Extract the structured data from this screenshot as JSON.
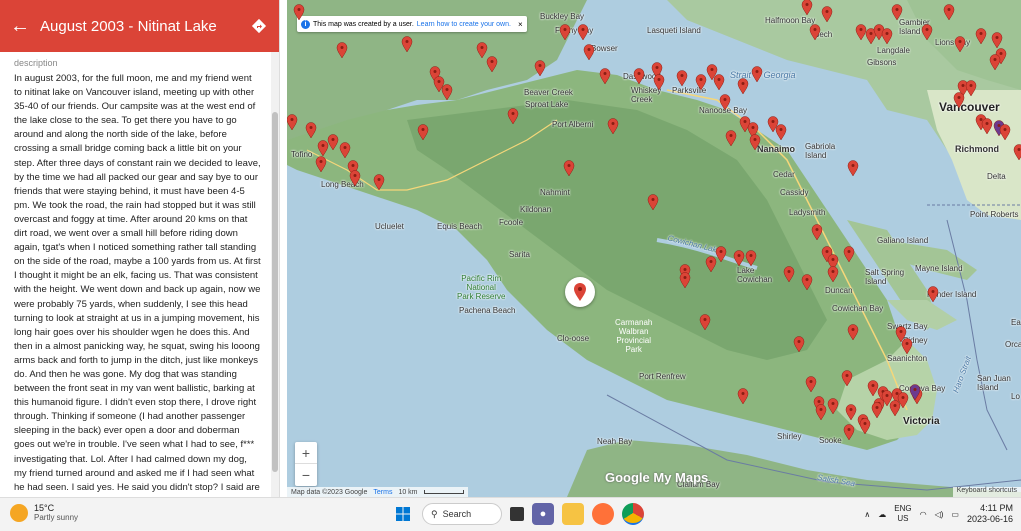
{
  "panel": {
    "title": "August 2003 - Nitinat Lake",
    "description_label": "description",
    "description": "In august 2003, for the full moon, me and my friend went to nitinat lake on Vancouver island, meeting up with other 35-40 of our friends. Our campsite was at the west end of the lake close to the sea. To get there you have to go around and along the north side of the lake, before crossing a small bridge coming back a little bit on your step. After three days of constant rain we decided to leave, by the time we had all packed our gear and say bye to our friends that were staying behind, it must have been 4-5 pm. We took the road, the rain had stopped but it was still overcast and foggy at time. After around 20 kms on that dirt road, we went over a small hill before riding down again, tgat's when I noticed something rather tall standing on the side of the road, maybe a 100 yards from us. At first I thought it might be an elk, facing us. That was consistent with the height. We went down and back up again, now we were probably 75 yards, when suddenly, I see this head turning to look at straight at us in a jumping movement, his long hair goes over his shoulder wgen he does this. And then in a almost panicking way, he squat, swing his looong arms back and forth to jump in the ditch, just like monkeys do. And then he was gone. My dog that was standing between the front seat in my van went ballistic, barking at this humanoid figure. I didn't even stop there, I drove right through. Thinking if someone (I had another passenger sleeping in the back) ever open a door and doberman goes out we're in trouble. I've seen what I had to see, f*** investigating that. Lol. After I had calmed down my dog, my friend turned around and asked me if I had seen what he had seen. I said yes. He said you didn't stop? I said are you crazy??? In a scary voice Lol So that was our sighting.. - Patrick Lepage report."
  },
  "map": {
    "notice_text": "This map was created by a user.",
    "notice_link": "Learn how to create your own.",
    "attribution": "Map data ©2023 Google",
    "terms": "Terms",
    "scale": "10 km",
    "keyboard": "Keyboard shortcuts",
    "logo": "Google My Maps",
    "zoom_in": "+",
    "zoom_out": "−",
    "labels": {
      "buckley_bay": "Buckley Bay",
      "lasqueti": "Lasqueti Island",
      "halfmoon": "Halfmoon Bay",
      "sechelt": "Sech",
      "gambier": "Gambier\nIsland",
      "lions_bay": "Lions Bay",
      "langdale": "Langdale",
      "gibsons": "Gibsons",
      "fanny_bay": "Fanny Bay",
      "bowser": "Bowser",
      "strait": "Strait of Georgia",
      "dashwood": "Dashwood",
      "whiskey": "Whiskey\nCreek",
      "parksville": "Parksville",
      "beaver": "Beaver Creek",
      "sproat": "Sproat Lake",
      "nanoose": "Nanoose Bay",
      "vancouver": "Vancouver",
      "port_alberni": "Port Alberni",
      "nanaimo": "Nanaimo",
      "gabriola": "Gabriola\nIsland",
      "richmond": "Richmond",
      "tofino": "Tofino",
      "delta": "Delta",
      "long_beach": "Long Beach",
      "cedar": "Cedar",
      "cassidy": "Cassidy",
      "nahmint": "Nahmint",
      "kildonan": "Kildonan",
      "ucluelet": "Ucluelet",
      "equis": "Equis Beach",
      "fcoole": "Fcoole",
      "ladysmith": "Ladysmith",
      "point_roberts": "Point Roberts",
      "sarita": "Sarita",
      "cowichan_lake_water": "Cowichan Lake",
      "galiano": "Galiano Island",
      "mayne": "Mayne Island",
      "salt_spring": "Salt Spring\nIsland",
      "pacific_rim": "Pacific Rim\nNational\nPark Reserve",
      "pachena": "Pachena Beach",
      "lake_cowichan": "Lake\nCowichan",
      "duncan": "Duncan",
      "pender": "Pender Island",
      "cowichan_bay": "Cowichan Bay",
      "carmanah": "Carmanah\nWalbran\nProvincial\nPark",
      "cloose": "Clo-oose",
      "swartz": "Swartz Bay",
      "sidney": "Sidney",
      "saanichton": "Saanichton",
      "san_juan": "San Juan\nIsland",
      "haro": "Haro Strait",
      "port_renfrew": "Port Renfrew",
      "cordova": "Cordova Bay",
      "shirley": "Shirley",
      "sooke": "Sooke",
      "victoria": "Victoria",
      "neah": "Neah Bay",
      "clallam": "Clallam Bay",
      "salish": "Salish Sea",
      "orca": "Orca",
      "ea": "Ea",
      "lo": "Lo"
    }
  },
  "taskbar": {
    "temp": "15°C",
    "weather": "Partly sunny",
    "search": "Search",
    "lang1": "ENG",
    "lang2": "US",
    "time": "4:11 PM",
    "date": "2023-06-16"
  }
}
